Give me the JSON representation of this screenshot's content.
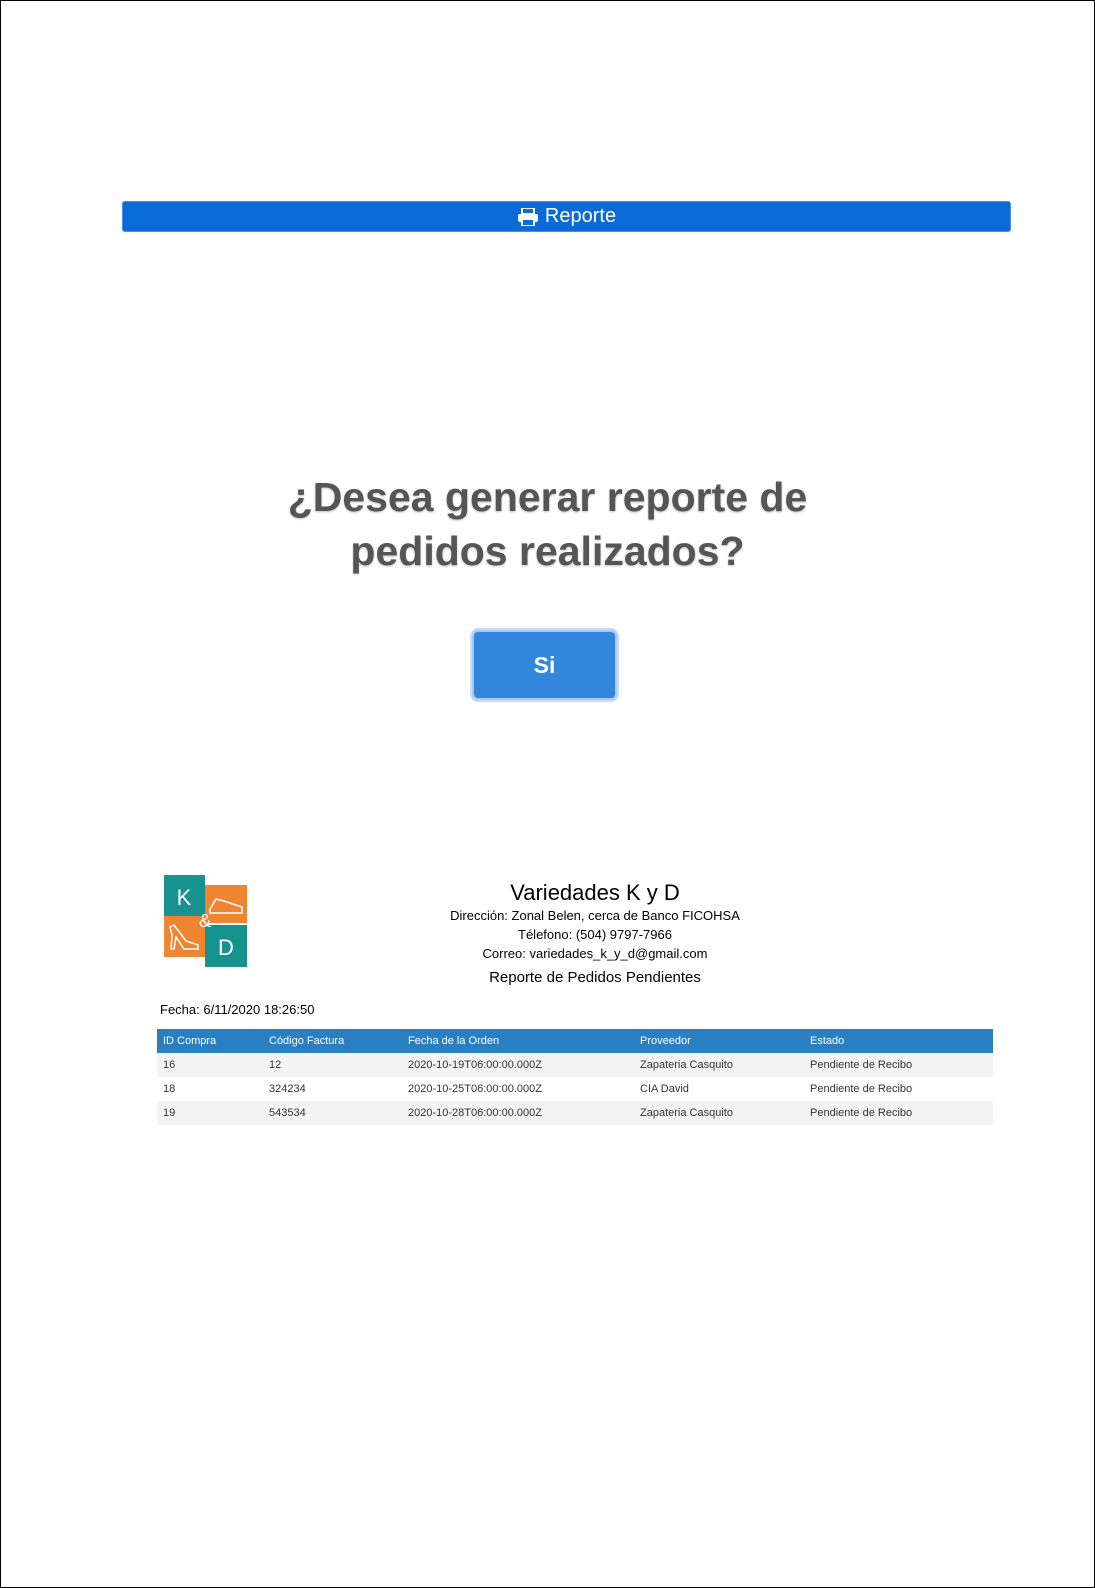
{
  "toolbar": {
    "report_label": "Reporte",
    "report_icon": "printer-icon",
    "accent": "#0a6ad8"
  },
  "dialog": {
    "question_line1": "¿Desea generar reporte de",
    "question_line2": "pedidos realizados?",
    "confirm_label": "Si"
  },
  "logo": {
    "letter_top": "K",
    "amp": "&",
    "letter_bottom": "D",
    "teal": "#16928f",
    "orange": "#ef8431"
  },
  "company": {
    "name": "Variedades K y D",
    "address": "Dirección: Zonal Belen, cerca de Banco FICOHSA",
    "phone": "Télefono: (504) 9797-7966",
    "email": "Correo: variedades_k_y_d@gmail.com",
    "report_title": "Reporte de Pedidos Pendientes"
  },
  "report": {
    "date": "Fecha: 6/11/2020 18:26:50",
    "columns": [
      "ID Compra",
      "Código Factura",
      "Fecha de la Orden",
      "Proveedor",
      "Estado"
    ],
    "rows": [
      [
        "16",
        "12",
        "2020-10-19T06:00:00.000Z",
        "Zapateria Casquito",
        "Pendiente de Recibo"
      ],
      [
        "18",
        "324234",
        "2020-10-25T06:00:00.000Z",
        "CIA David",
        "Pendiente de Recibo"
      ],
      [
        "19",
        "543534",
        "2020-10-28T06:00:00.000Z",
        "Zapateria Casquito",
        "Pendiente de Recibo"
      ]
    ]
  }
}
